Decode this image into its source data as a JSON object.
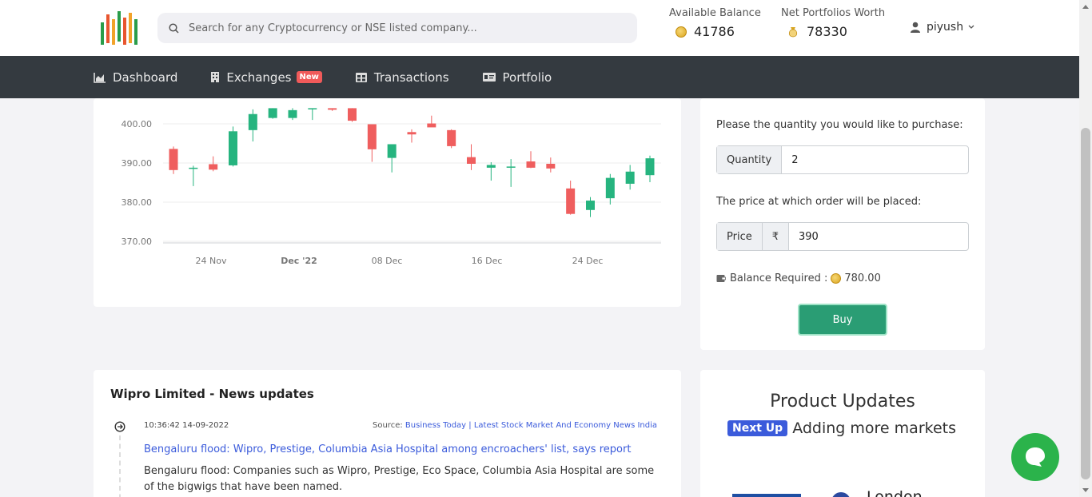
{
  "header": {
    "search_placeholder": "Search for any Cryptocurrency or NSE listed company...",
    "available_balance_label": "Available Balance",
    "available_balance_value": "41786",
    "net_worth_label": "Net Portfolios Worth",
    "net_worth_value": "78330",
    "username": "piyush"
  },
  "nav": {
    "items": [
      {
        "label": "Dashboard",
        "icon": "chart-area-icon"
      },
      {
        "label": "Exchanges",
        "icon": "building-icon",
        "badge": "New"
      },
      {
        "label": "Transactions",
        "icon": "table-icon"
      },
      {
        "label": "Portfolio",
        "icon": "id-card-icon"
      }
    ]
  },
  "chart_data": {
    "type": "candlestick",
    "y_ticks": [
      "400.00",
      "390.00",
      "380.00",
      "370.00"
    ],
    "x_ticks": [
      "24 Nov",
      "Dec '22",
      "08 Dec",
      "16 Dec",
      "24 Dec"
    ],
    "ylim": [
      370,
      404
    ],
    "up_color": "#26b47f",
    "down_color": "#ef5e5e",
    "candles": [
      {
        "o": 393.6,
        "h": 394.2,
        "l": 387.2,
        "c": 388.2
      },
      {
        "o": 388.8,
        "h": 389.3,
        "l": 384.1,
        "c": 388.8
      },
      {
        "o": 389.7,
        "h": 391.7,
        "l": 387.9,
        "c": 388.3
      },
      {
        "o": 389.4,
        "h": 399.3,
        "l": 389.1,
        "c": 398.1
      },
      {
        "o": 398.4,
        "h": 403.7,
        "l": 395.5,
        "c": 402.5
      },
      {
        "o": 401.5,
        "h": 404.0,
        "l": 401.3,
        "c": 404.0
      },
      {
        "o": 401.5,
        "h": 404.0,
        "l": 401.0,
        "c": 403.5
      },
      {
        "o": 403.8,
        "h": 404.0,
        "l": 401.0,
        "c": 404.0
      },
      {
        "o": 404.0,
        "h": 404.0,
        "l": 403.3,
        "c": 403.6
      },
      {
        "o": 404.0,
        "h": 404.0,
        "l": 400.5,
        "c": 400.8
      },
      {
        "o": 399.9,
        "h": 399.9,
        "l": 390.3,
        "c": 393.5
      },
      {
        "o": 391.3,
        "h": 392.4,
        "l": 387.6,
        "c": 394.8
      },
      {
        "o": 397.9,
        "h": 398.6,
        "l": 395.2,
        "c": 397.3
      },
      {
        "o": 400.1,
        "h": 402.1,
        "l": 399.8,
        "c": 399.1
      },
      {
        "o": 398.4,
        "h": 398.6,
        "l": 393.8,
        "c": 394.3
      },
      {
        "o": 391.5,
        "h": 394.8,
        "l": 388.2,
        "c": 389.8
      },
      {
        "o": 388.8,
        "h": 390.2,
        "l": 385.5,
        "c": 389.5
      },
      {
        "o": 389.1,
        "h": 391.0,
        "l": 383.9,
        "c": 389.1
      },
      {
        "o": 390.4,
        "h": 393.0,
        "l": 388.7,
        "c": 388.8
      },
      {
        "o": 389.8,
        "h": 391.4,
        "l": 387.6,
        "c": 388.6
      },
      {
        "o": 383.5,
        "h": 385.5,
        "l": 376.8,
        "c": 377.0
      },
      {
        "o": 378.0,
        "h": 381.3,
        "l": 376.2,
        "c": 380.4
      },
      {
        "o": 381.0,
        "h": 387.2,
        "l": 379.4,
        "c": 386.2
      },
      {
        "o": 384.7,
        "h": 389.5,
        "l": 383.2,
        "c": 387.8
      },
      {
        "o": 386.9,
        "h": 391.9,
        "l": 385.1,
        "c": 391.2
      }
    ]
  },
  "order": {
    "quantity_prompt": "Please the quantity you would like to purchase:",
    "quantity_label": "Quantity",
    "quantity_value": "2",
    "price_prompt": "The price at which order will be placed:",
    "price_label": "Price",
    "currency_symbol": "₹",
    "price_value": "390",
    "balance_required_label": "Balance Required :",
    "balance_required_value": "780.00",
    "buy_label": "Buy"
  },
  "news": {
    "title": "Wipro Limited - News updates",
    "items": [
      {
        "time": "10:36:42 14-09-2022",
        "source_label": "Source:",
        "source": "Business Today | Latest Stock Market And Economy News India",
        "headline": "Bengaluru flood: Wipro, Prestige, Columbia Asia Hospital among encroachers' list, says report",
        "description": "Bengaluru flood: Companies such as Wipro, Prestige, Eco Space, Columbia Asia Hospital are some of the bigwigs that have been named."
      }
    ]
  },
  "updates": {
    "title": "Product Updates",
    "badge": "Next Up",
    "text": "Adding more markets",
    "logo_text": "London"
  }
}
